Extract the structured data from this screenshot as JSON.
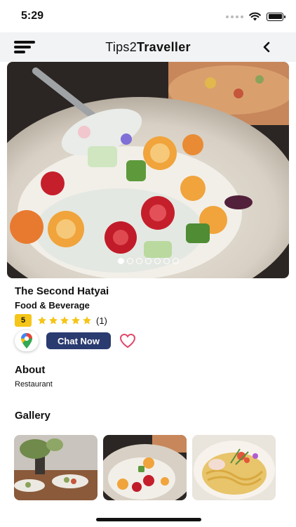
{
  "status_bar": {
    "time": "5:29"
  },
  "header": {
    "title_part1": "Tips2",
    "title_part2": "Traveller"
  },
  "hero": {
    "image_subject": "salad with cherry tomatoes and cheese on a spoon",
    "slide_count": 7,
    "active_slide": 1
  },
  "place": {
    "name": "The Second Hatyai",
    "category": "Food & Beverage",
    "rating": "5",
    "stars_filled": 5,
    "review_count": "(1)",
    "star_color": "#f5c518"
  },
  "actions": {
    "maps_icon": "google-maps-icon",
    "chat_label": "Chat Now",
    "chat_color": "#2a3b70",
    "favorite_icon": "heart-icon",
    "favorite_color": "#e0486a"
  },
  "about": {
    "heading": "About",
    "text": "Restaurant"
  },
  "gallery": {
    "heading": "Gallery",
    "items": [
      {
        "subject": "restaurant table with dishes and plant"
      },
      {
        "subject": "salad with cherry tomatoes"
      },
      {
        "subject": "noodle dish with garnish"
      }
    ]
  }
}
